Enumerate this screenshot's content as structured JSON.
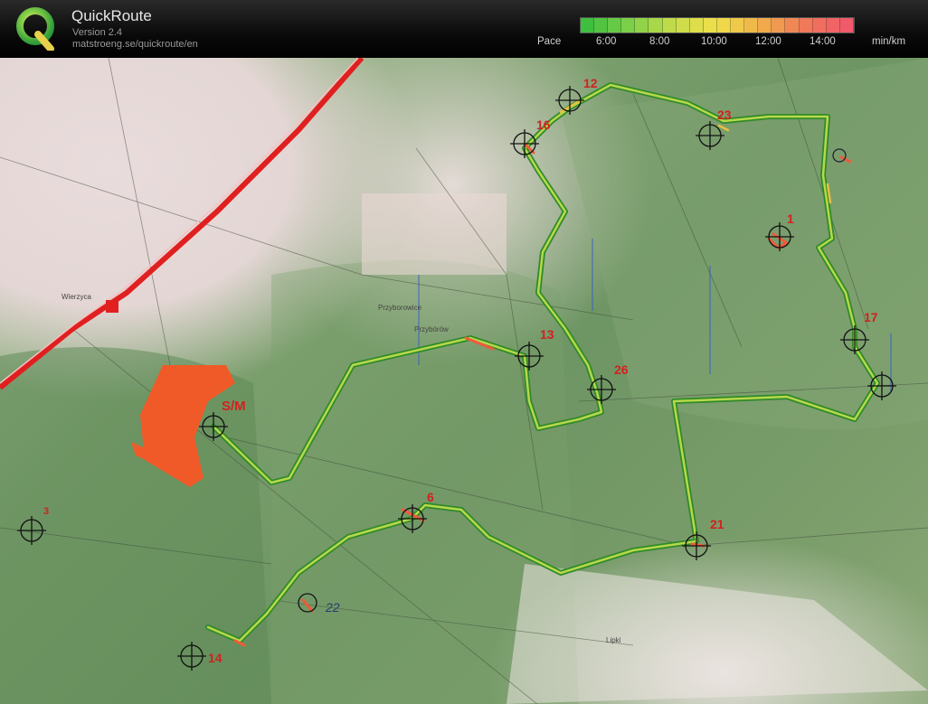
{
  "app": {
    "name": "QuickRoute",
    "version": "Version 2.4",
    "url": "matstroeng.se/quickroute/en"
  },
  "pace_legend": {
    "label": "Pace",
    "ticks": [
      "6:00",
      "8:00",
      "10:00",
      "12:00",
      "14:00"
    ],
    "unit": "min/km",
    "colors": [
      "#3fbf3f",
      "#7fd04a",
      "#c8dc4a",
      "#f0e04a",
      "#f0b04a",
      "#f07a5a",
      "#f05a6a"
    ]
  },
  "map": {
    "start_label": "S/M",
    "controls": [
      {
        "id": "12",
        "label": "12"
      },
      {
        "id": "16",
        "label": "16"
      },
      {
        "id": "23",
        "label": "23"
      },
      {
        "id": "1",
        "label": "1"
      },
      {
        "id": "7",
        "label": "17"
      },
      {
        "id": "13",
        "label": "13"
      },
      {
        "id": "26",
        "label": "26"
      },
      {
        "id": "6",
        "label": "6"
      },
      {
        "id": "21",
        "label": "21"
      },
      {
        "id": "22",
        "label": "22"
      },
      {
        "id": "14",
        "label": "14"
      },
      {
        "id": "3",
        "label": "3"
      }
    ],
    "place_names": [
      "Wierzyca",
      "Przyborowice",
      "Lipki",
      "Przybórów"
    ]
  }
}
